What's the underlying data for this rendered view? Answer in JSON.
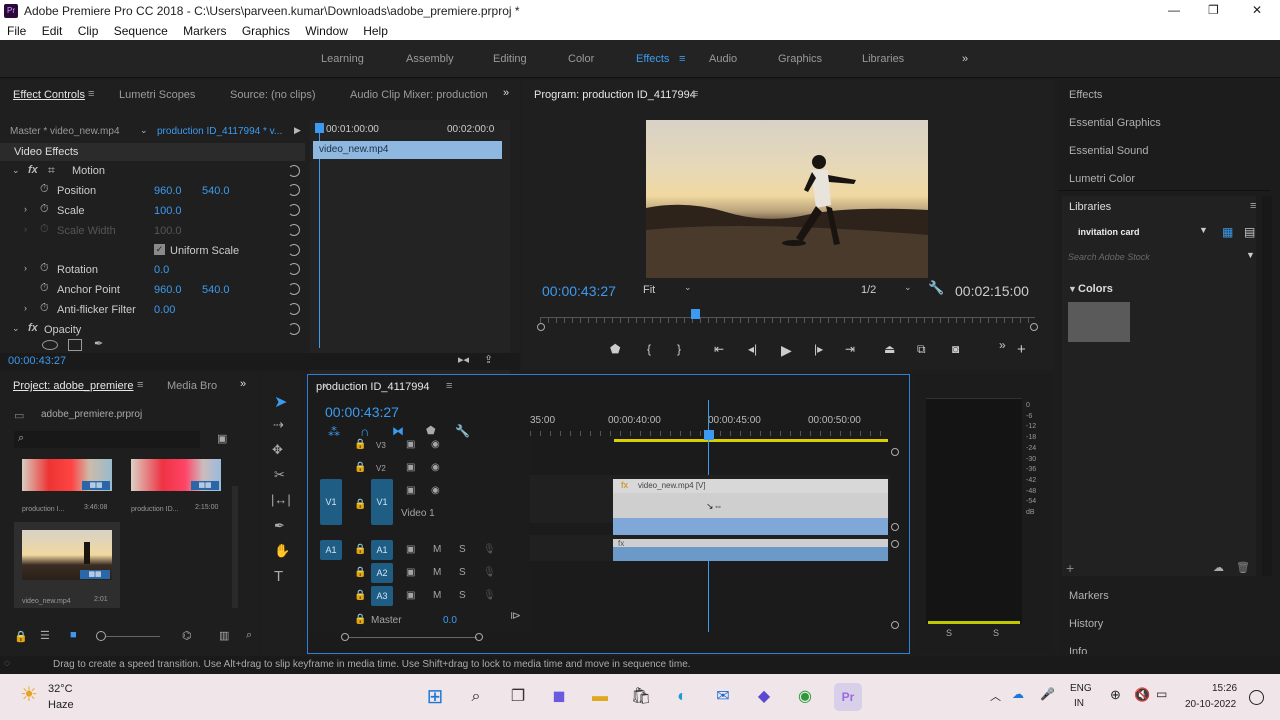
{
  "window": {
    "title": "Adobe Premiere Pro CC 2018 - C:\\Users\\parveen.kumar\\Downloads\\adobe_premiere.prproj *",
    "minimize": "—",
    "maximize": "❐",
    "close": "✕"
  },
  "menu": [
    "File",
    "Edit",
    "Clip",
    "Sequence",
    "Markers",
    "Graphics",
    "Window",
    "Help"
  ],
  "workspaces": [
    "Learning",
    "Assembly",
    "Editing",
    "Color",
    "Effects",
    "Audio",
    "Graphics",
    "Libraries"
  ],
  "workspaces_active": "Effects",
  "effect_panel": {
    "tabs": [
      "Effect Controls",
      "Lumetri Scopes",
      "Source: (no clips)",
      "Audio Clip Mixer: production"
    ],
    "master": "Master * video_new.mp4",
    "sequence": "production ID_4117994 * v...",
    "time1": "00:01:00:00",
    "time2": "00:02:00:0",
    "clip": "video_new.mp4",
    "section": "Video Effects",
    "motion": "Motion",
    "position": {
      "label": "Position",
      "x": "960.0",
      "y": "540.0"
    },
    "scale": {
      "label": "Scale",
      "v": "100.0"
    },
    "scale_width": {
      "label": "Scale Width",
      "v": "100.0"
    },
    "uniform": "Uniform Scale",
    "rotation": {
      "label": "Rotation",
      "v": "0.0"
    },
    "anchor": {
      "label": "Anchor Point",
      "x": "960.0",
      "y": "540.0"
    },
    "antiflicker": {
      "label": "Anti-flicker Filter",
      "v": "0.00"
    },
    "opacity": "Opacity",
    "timecode": "00:00:43:27"
  },
  "program": {
    "title": "Program: production ID_4117994",
    "timecode": "00:00:43:27",
    "fit": "Fit",
    "res": "1/2",
    "duration": "00:02:15:00"
  },
  "right_panel": {
    "items": [
      "Effects",
      "Essential Graphics",
      "Essential Sound",
      "Lumetri Color",
      "Libraries"
    ],
    "library_select": "invitation card",
    "search_placeholder": "Search Adobe Stock",
    "colors": "Colors",
    "bottom": [
      "Markers",
      "History",
      "Info"
    ],
    "swatch": "#5a5a5a"
  },
  "project": {
    "tabs": [
      "Project: adobe_premiere",
      "Media Bro"
    ],
    "file": "adobe_premiere.prproj",
    "items": [
      {
        "name": "production I...",
        "dur": "3:46:08"
      },
      {
        "name": "production ID...",
        "dur": "2:15:00"
      },
      {
        "name": "video_new.mp4",
        "dur": "2:01"
      }
    ]
  },
  "timeline": {
    "title": "production ID_4117994",
    "timecode": "00:00:43:27",
    "ruler": [
      "35:00",
      "00:00:40:00",
      "00:00:45:00",
      "00:00:50:00"
    ],
    "tracks": {
      "v3": "V3",
      "v2": "V2",
      "v1": "V1",
      "video1": "Video 1",
      "a1": "A1",
      "a2": "A2",
      "a3": "A3",
      "master": "Master",
      "master_val": "0.0",
      "m": "M",
      "s": "S"
    },
    "clip": "video_new.mp4 [V]"
  },
  "meter": {
    "scale": [
      "0",
      "-6",
      "-12",
      "-18",
      "-24",
      "-30",
      "-36",
      "-42",
      "-48",
      "-54",
      "dB"
    ],
    "s": "S"
  },
  "status": "Drag to create a speed transition. Use Alt+drag to slip keyframe in media time. Use Shift+drag to lock to media time and move in sequence time.",
  "taskbar": {
    "temp": "32°C",
    "weather": "Haze",
    "lang1": "ENG",
    "lang2": "IN",
    "time": "15:26",
    "date": "20-10-2022"
  }
}
